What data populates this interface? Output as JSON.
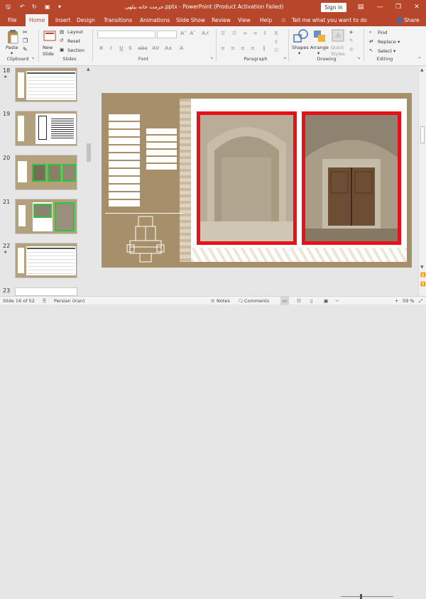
{
  "titlebar": {
    "title": "حرمت خانه ببلهی.pptx  -  PowerPoint (Product Activation Failed)",
    "sign_in": "Sign in",
    "minimize": "—",
    "restore": "❐",
    "close": "✕"
  },
  "tabs": [
    "File",
    "Home",
    "Insert",
    "Design",
    "Transitions",
    "Animations",
    "Slide Show",
    "Review",
    "View",
    "Help"
  ],
  "tell_me": "Tell me what you want to do",
  "share": "Share",
  "ribbon": {
    "paste": "Paste",
    "new_slide": "New Slide",
    "layout": "Layout",
    "reset": "Reset",
    "section": "Section",
    "shapes": "Shapes",
    "arrange": "Arrange",
    "quick_styles": "Quick Styles",
    "find": "Find",
    "replace": "Replace",
    "select": "Select",
    "groups": {
      "clipboard": "Clipboard",
      "slides": "Slides",
      "font": "Font",
      "paragraph": "Paragraph",
      "drawing": "Drawing",
      "editing": "Editing"
    }
  },
  "slides_panel": {
    "slides": [
      {
        "number": "18",
        "star": "★"
      },
      {
        "number": "19",
        "star": ""
      },
      {
        "number": "20",
        "star": ""
      },
      {
        "number": "21",
        "star": ""
      },
      {
        "number": "22",
        "star": "★"
      },
      {
        "number": "23",
        "star": ""
      }
    ]
  },
  "status": {
    "slide_of": "Slide 16 of 52",
    "language": "Persian (Iran)",
    "notes": "Notes",
    "comments": "Comments",
    "zoom": "59 %"
  },
  "colors": {
    "brand": "#b7472a",
    "slide_bg": "#a68f69",
    "photo_frame": "#e8111a",
    "active_tab_text": "#b7472a"
  }
}
